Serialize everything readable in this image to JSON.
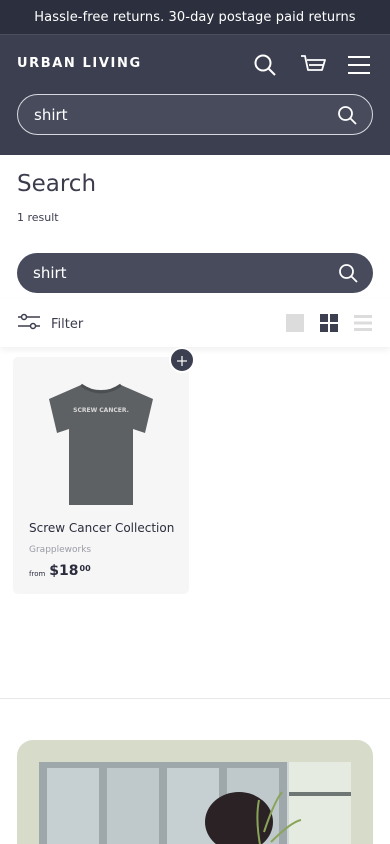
{
  "announcement": "Hassle-free returns. 30-day postage paid returns",
  "header": {
    "logo": "URBAN LIVING",
    "search_value": "shirt",
    "icons": [
      "search-icon",
      "cart-icon",
      "menu-icon"
    ]
  },
  "page": {
    "title": "Search",
    "result_count": "1 result",
    "search_value": "shirt"
  },
  "toolbar": {
    "filter_label": "Filter",
    "view_options": [
      "large-grid-view-icon",
      "small-grid-view-icon",
      "list-view-icon"
    ],
    "active_view": "small-grid-view-icon"
  },
  "products": [
    {
      "image_text": "SCREW CANCER.",
      "title": "Screw Cancer Collection",
      "vendor": "Grappleworks",
      "price_prefix": "from",
      "price_main": "$18",
      "price_cents": "00"
    }
  ],
  "colors": {
    "announcement_bg": "#2c2f3d",
    "header_bg": "#3b3f50",
    "card_bg": "#f6f6f6",
    "promo_bg": "#d6dcc9"
  }
}
